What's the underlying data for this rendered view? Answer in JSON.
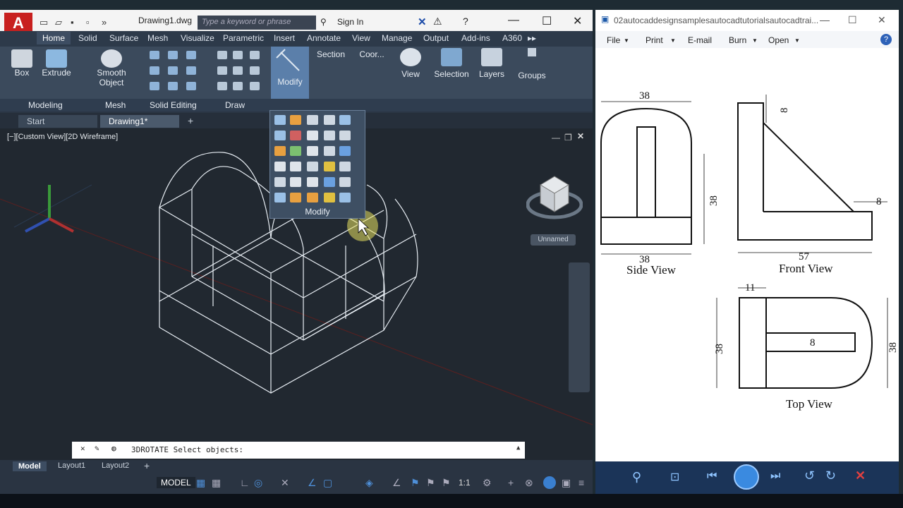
{
  "autocad": {
    "doc_title": "Drawing1.dwg",
    "search_placeholder": "Type a keyword or phrase",
    "sign_in": "Sign In",
    "ribbon_tabs": [
      "Home",
      "Solid",
      "Surface",
      "Mesh",
      "Visualize",
      "Parametric",
      "Insert",
      "Annotate",
      "View",
      "Manage",
      "Output",
      "Add-ins",
      "A360"
    ],
    "active_tab": "Home",
    "buttons": {
      "box": "Box",
      "extrude": "Extrude",
      "smooth_object": "Smooth\nObject",
      "modify": "Modify",
      "section": "Section",
      "coord": "Coor...",
      "view": "View",
      "selection": "Selection",
      "layers": "Layers",
      "groups": "Groups"
    },
    "panels": [
      "Modeling",
      "Mesh",
      "Solid Editing",
      "Draw"
    ],
    "doc_tabs": [
      "Start",
      "Drawing1*"
    ],
    "viewport_label": "[−][Custom View][2D Wireframe]",
    "viewcube_label": "Unnamed",
    "modify_panel_title": "Modify",
    "command_text": "3DROTATE Select objects:",
    "layout_tabs": [
      "Model",
      "Layout1",
      "Layout2"
    ],
    "status_model": "MODEL",
    "status_scale": "1:1"
  },
  "viewer": {
    "title": "02autocaddesignsamplesautocadtutorialsautocadtrai...",
    "menu": [
      "File",
      "Print",
      "E-mail",
      "Burn",
      "Open"
    ],
    "drawing": {
      "side_view": {
        "label": "Side View",
        "dim_top": "38",
        "dim_bottom": "38",
        "dim_right": "38"
      },
      "front_view": {
        "label": "Front View",
        "dim_top": "8",
        "dim_right": "8",
        "dim_bottom": "57"
      },
      "top_view": {
        "label": "Top View",
        "dim_top": "11",
        "dim_left": "38",
        "dim_right": "38",
        "dim_center": "8"
      }
    }
  },
  "colors": {
    "accent": "#c8201f",
    "ribbon": "#3b4a5c",
    "viewport": "#212830",
    "highlight": "#5b7faa"
  }
}
